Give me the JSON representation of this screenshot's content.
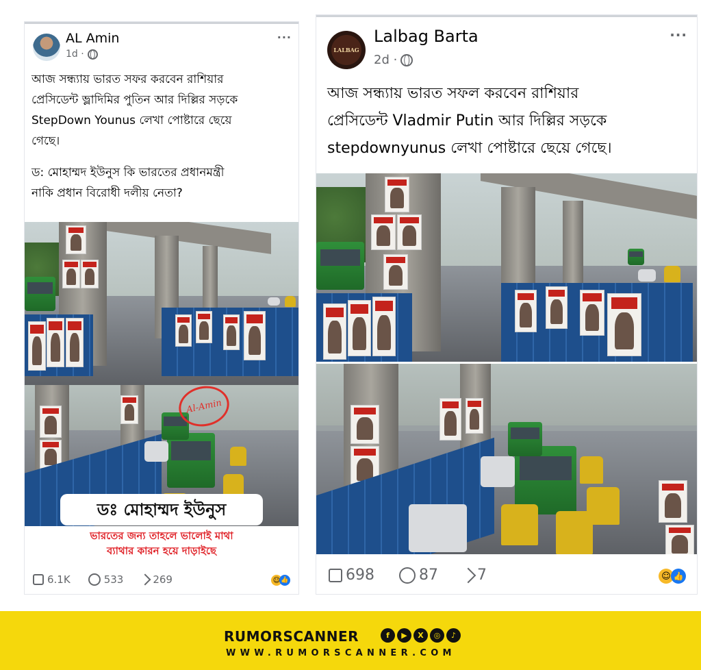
{
  "left_post": {
    "author": "AL Amin",
    "time": "1d ·",
    "more": "···",
    "text_line1": "আজ সন্ধ্যায় ভারত সফর করবেন রাশিয়ার",
    "text_line2": "প্রেসিডেন্ট ভ্লাদিমির পুতিন আর দিল্লির সড়কে",
    "text_line3": "StepDown Younus লেখা পোষ্টারে ছেয়ে",
    "text_line4": "গেছে।",
    "text_line5": "ড: মোহাম্মদ ইউনুস কি ভারতের প্রধানমন্ত্রী",
    "text_line6": "নাকি প্রধান বিরোধী দলীয় নেতা?",
    "banner_name": "ডঃ মোহাম্মদ ইউনুস",
    "banner_sub1": "ভারতের জন্য তাহলে ভালোই মাথা",
    "banner_sub2": "ব্যাথার কারন হয়ে দাড়াইছে",
    "stamp": "Al-Amin",
    "likes": "6.1K",
    "comments": "533",
    "shares": "269"
  },
  "right_post": {
    "author": "Lalbag Barta",
    "avatar_text": "LALBAG",
    "time": "2d ·",
    "more": "···",
    "text_line1": "আজ সন্ধ্যায় ভারত সফল করবেন রাশিয়ার",
    "text_line2": "প্রেসিডেন্ট Vladmir Putin আর দিল্লির সড়কে",
    "text_line3": "stepdownyunus লেখা পোষ্টারে ছেয়ে গেছে।",
    "likes": "698",
    "comments": "87",
    "shares": "7"
  },
  "footer": {
    "brand": "RUMORSCANNER",
    "website": "WWW.RUMORSCANNER.COM",
    "icons": [
      "facebook-icon",
      "youtube-icon",
      "x-icon",
      "instagram-icon",
      "tiktok-icon"
    ]
  },
  "colors": {
    "accent_yellow": "#f5d80c",
    "like_blue": "#1877f2",
    "banner_red": "#e0242a"
  }
}
